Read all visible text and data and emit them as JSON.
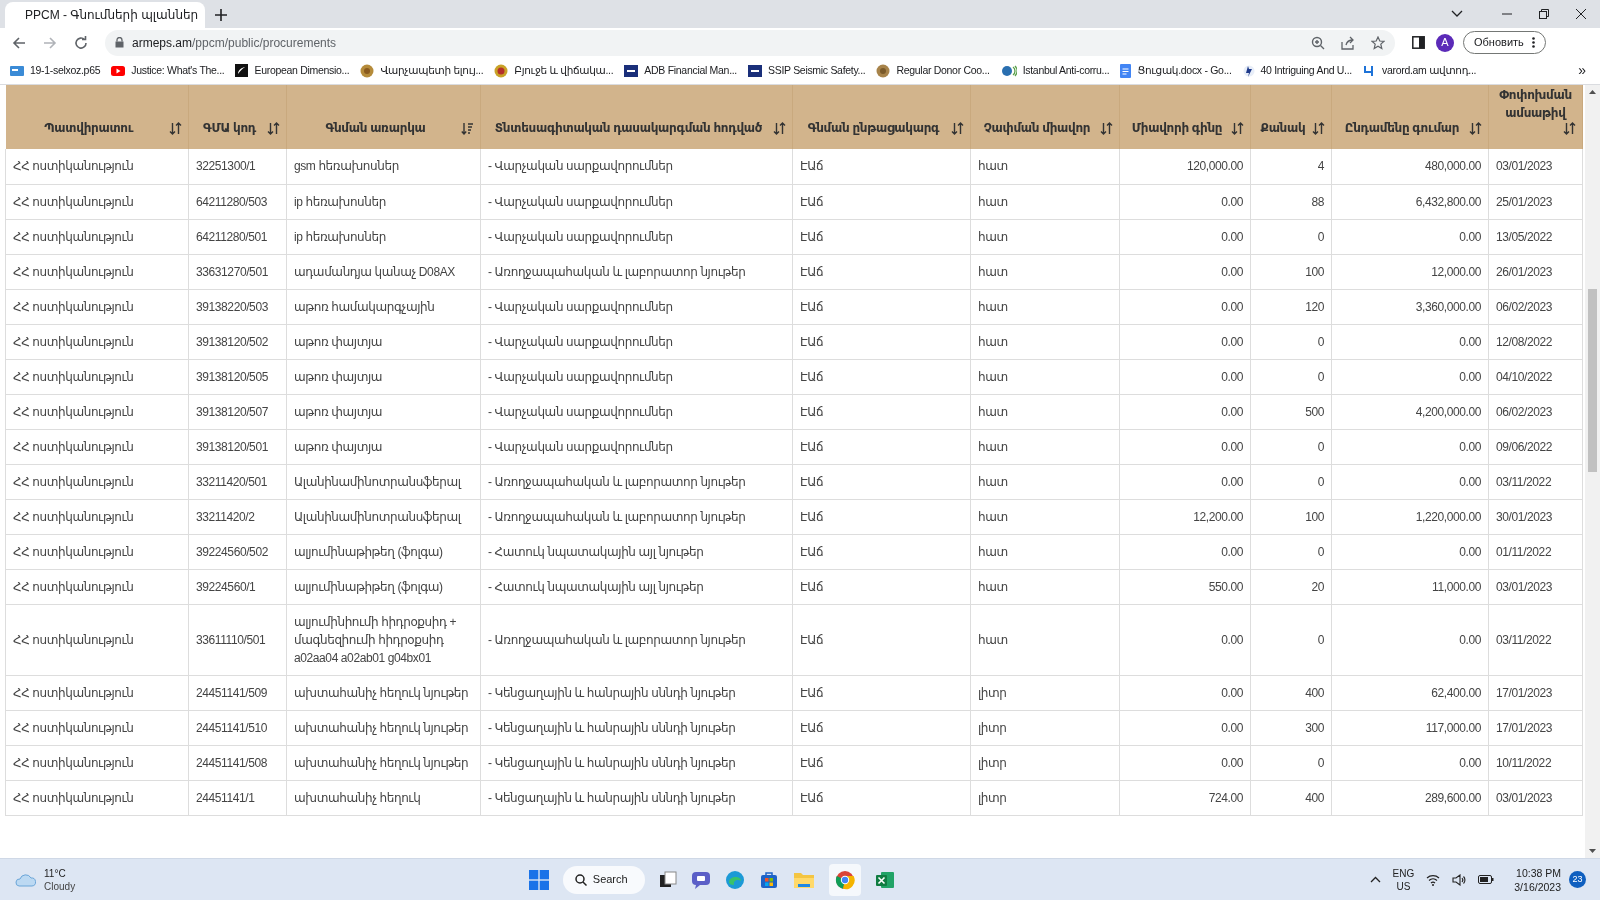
{
  "browser": {
    "tab_title": "PPCM - Գնումների պլաններ",
    "url_host": "armeps.am",
    "url_path": "/ppcm/public/procurements",
    "profile_initial": "A",
    "update_button": "Обновить",
    "bookmarks": [
      "19-1-selxoz.p65",
      "Justice: What's The...",
      "European Dimensio...",
      "Վարչապետի ելույ...",
      "Բյուջե և վիճակա...",
      "ADB Financial Man...",
      "SSIP Seismic Safety...",
      "Regular Donor Coo...",
      "Istanbul Anti-corru...",
      "Ցուցակ.docx - Go...",
      "40 Intriguing And U...",
      "varord.am ավտոդ..."
    ],
    "more_bookmarks": "»"
  },
  "table": {
    "columns": [
      {
        "label": "Պատվիրատու",
        "sorted": false
      },
      {
        "label": "ԳՄԱ կոդ",
        "sorted": false
      },
      {
        "label": "Գնման առարկա",
        "sorted": true
      },
      {
        "label": "Տնտեսագիտական դասակարգման հոդված",
        "sorted": false
      },
      {
        "label": "Գնման ընթացակարգ",
        "sorted": false
      },
      {
        "label": "Չափման միավոր",
        "sorted": false
      },
      {
        "label": "Միավորի գինը",
        "sorted": false
      },
      {
        "label": "Քանակ",
        "sorted": false
      },
      {
        "label": "Ընդամենը գումար",
        "sorted": false
      },
      {
        "label": "Փոփոխման ամսաթիվ",
        "sorted": false
      }
    ],
    "rows": [
      [
        "ՀՀ ոստիկանություն",
        "32251300/1",
        "gsm հեռախոսներ",
        "- Վարչական սարքավորումներ",
        "ԷԱճ",
        "հատ",
        "120,000.00",
        "4",
        "480,000.00",
        "03/01/2023"
      ],
      [
        "ՀՀ ոստիկանություն",
        "64211280/503",
        "ip հեռախոսներ",
        "- Վարչական սարքավորումներ",
        "ԷԱճ",
        "հատ",
        "0.00",
        "88",
        "6,432,800.00",
        "25/01/2023"
      ],
      [
        "ՀՀ ոստիկանություն",
        "64211280/501",
        "ip հեռախոսներ",
        "- Վարչական սարքավորումներ",
        "ԷԱճ",
        "հատ",
        "0.00",
        "0",
        "0.00",
        "13/05/2022"
      ],
      [
        "ՀՀ ոստիկանություն",
        "33631270/501",
        "ադամանդյա կանաչ D08AX",
        "- Առողջապահական և լաբորատոր նյութեր",
        "ԷԱճ",
        "հատ",
        "0.00",
        "100",
        "12,000.00",
        "26/01/2023"
      ],
      [
        "ՀՀ ոստիկանություն",
        "39138220/503",
        "աթոռ համակարգչային",
        "- Վարչական սարքավորումներ",
        "ԷԱճ",
        "հատ",
        "0.00",
        "120",
        "3,360,000.00",
        "06/02/2023"
      ],
      [
        "ՀՀ ոստիկանություն",
        "39138120/502",
        "աթոռ փայտյա",
        "- Վարչական սարքավորումներ",
        "ԷԱճ",
        "հատ",
        "0.00",
        "0",
        "0.00",
        "12/08/2022"
      ],
      [
        "ՀՀ ոստիկանություն",
        "39138120/505",
        "աթոռ փայտյա",
        "- Վարչական սարքավորումներ",
        "ԷԱճ",
        "հատ",
        "0.00",
        "0",
        "0.00",
        "04/10/2022"
      ],
      [
        "ՀՀ ոստիկանություն",
        "39138120/507",
        "աթոռ փայտյա",
        "- Վարչական սարքավորումներ",
        "ԷԱճ",
        "հատ",
        "0.00",
        "500",
        "4,200,000.00",
        "06/02/2023"
      ],
      [
        "ՀՀ ոստիկանություն",
        "39138120/501",
        "աթոռ փայտյա",
        "- Վարչական սարքավորումներ",
        "ԷԱճ",
        "հատ",
        "0.00",
        "0",
        "0.00",
        "09/06/2022"
      ],
      [
        "ՀՀ ոստիկանություն",
        "33211420/501",
        "Ալանինամինոտրանսֆերալ",
        "- Առողջապահական և լաբորատոր նյութեր",
        "ԷԱճ",
        "հատ",
        "0.00",
        "0",
        "0.00",
        "03/11/2022"
      ],
      [
        "ՀՀ ոստիկանություն",
        "33211420/2",
        "Ալանինամինոտրանսֆերալ",
        "- Առողջապահական և լաբորատոր նյութեր",
        "ԷԱճ",
        "հատ",
        "12,200.00",
        "100",
        "1,220,000.00",
        "30/01/2023"
      ],
      [
        "ՀՀ ոստիկանություն",
        "39224560/502",
        "ալյումինաթիթեղ (ֆոլգա)",
        "- Հատուկ նպատակային այլ նյութեր",
        "ԷԱճ",
        "հատ",
        "0.00",
        "0",
        "0.00",
        "01/11/2022"
      ],
      [
        "ՀՀ ոստիկանություն",
        "39224560/1",
        "ալյումինաթիթեղ (ֆոլգա)",
        "- Հատուկ նպատակային այլ նյութեր",
        "ԷԱճ",
        "հատ",
        "550.00",
        "20",
        "11,000.00",
        "03/01/2023"
      ],
      [
        "ՀՀ ոստիկանություն",
        "33611110/501",
        "ալյումինիումի հիդրօքսիդ + մագնեզիումի հիդրօքսիդ a02aa04 a02ab01 g04bx01",
        "- Առողջապահական և լաբորատոր նյութեր",
        "ԷԱճ",
        "հատ",
        "0.00",
        "0",
        "0.00",
        "03/11/2022"
      ],
      [
        "ՀՀ ոստիկանություն",
        "24451141/509",
        "ախտահանիչ հեղուկ նյութեր",
        "- Կենցաղային և հանրային սննդի նյութեր",
        "ԷԱճ",
        "լիտր",
        "0.00",
        "400",
        "62,400.00",
        "17/01/2023"
      ],
      [
        "ՀՀ ոստիկանություն",
        "24451141/510",
        "ախտահանիչ հեղուկ նյութեր",
        "- Կենցաղային և հանրային սննդի նյութեր",
        "ԷԱճ",
        "լիտր",
        "0.00",
        "300",
        "117,000.00",
        "17/01/2023"
      ],
      [
        "ՀՀ ոստիկանություն",
        "24451141/508",
        "ախտահանիչ հեղուկ նյութեր",
        "- Կենցաղային և հանրային սննդի նյութեր",
        "ԷԱճ",
        "լիտր",
        "0.00",
        "0",
        "0.00",
        "10/11/2022"
      ],
      [
        "ՀՀ ոստիկանություն",
        "24451141/1",
        "ախտահանիչ հեղուկ",
        "- Կենցաղային և հանրային սննդի նյութեր",
        "ԷԱճ",
        "լիտր",
        "724.00",
        "400",
        "289,600.00",
        "03/01/2023"
      ]
    ]
  },
  "taskbar": {
    "temperature": "11°C",
    "weather": "Cloudy",
    "search": "Search",
    "language": "ENG",
    "region": "US",
    "time": "10:38 PM",
    "date": "3/16/2023",
    "notifications": "23"
  }
}
